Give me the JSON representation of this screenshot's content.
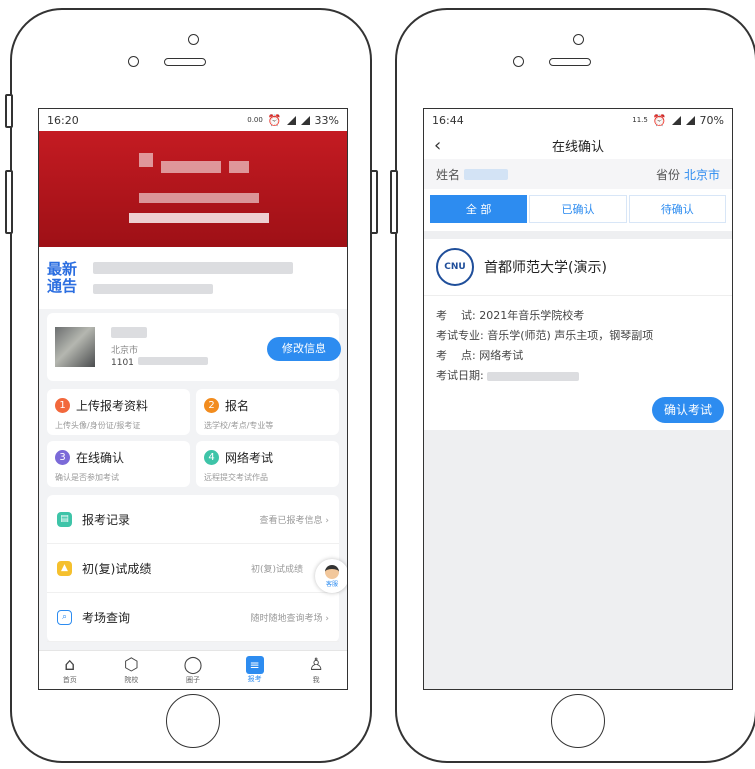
{
  "left": {
    "status": {
      "time": "16:20",
      "speed": "0.00",
      "battery": "33%"
    },
    "notice": {
      "title": "最新通告"
    },
    "profile": {
      "city": "北京市",
      "id_prefix": "1101",
      "edit_button": "修改信息"
    },
    "steps": [
      {
        "num": "1",
        "title": "上传报考资料",
        "sub": "上传头像/身份证/报考证",
        "color": "#f2683c"
      },
      {
        "num": "2",
        "title": "报名",
        "sub": "选学校/考点/专业等",
        "color": "#f28c1e"
      },
      {
        "num": "3",
        "title": "在线确认",
        "sub": "确认是否参加考试",
        "color": "#7b6ad8"
      },
      {
        "num": "4",
        "title": "网络考试",
        "sub": "远程提交考试作品",
        "color": "#3ec4a8"
      }
    ],
    "list": [
      {
        "label": "报考记录",
        "hint": "查看已报考信息",
        "color": "#3ec4a8"
      },
      {
        "label": "初(复)试成绩",
        "hint": "初(复)试成绩",
        "color": "#f5c02e"
      },
      {
        "label": "考场查询",
        "hint": "随时随地查询考场",
        "color": "#2d8cf0"
      }
    ],
    "customer_service": "客服",
    "tabs": [
      {
        "label": "首页",
        "icon": "⌂"
      },
      {
        "label": "院校",
        "icon": "⬡"
      },
      {
        "label": "圈子",
        "icon": "◯"
      },
      {
        "label": "报考",
        "icon": "≡"
      },
      {
        "label": "我",
        "icon": "♙"
      }
    ]
  },
  "right": {
    "status": {
      "time": "16:44",
      "speed": "11.5",
      "battery": "70%"
    },
    "title": "在线确认",
    "name_label": "姓名",
    "province_label": "省份",
    "province_value": "北京市",
    "filters": [
      "全 部",
      "已确认",
      "待确认"
    ],
    "card": {
      "seal_text": "CNU",
      "university": "首都师范大学(演示)",
      "exam_label": "考    试:",
      "exam_value": "2021年音乐学院校考",
      "major_label": "考试专业:",
      "major_value": "音乐学(师范) 声乐主项，钢琴副项",
      "site_label": "考    点:",
      "site_value": "网络考试",
      "date_label": "考试日期:",
      "confirm_button": "确认考试"
    }
  }
}
